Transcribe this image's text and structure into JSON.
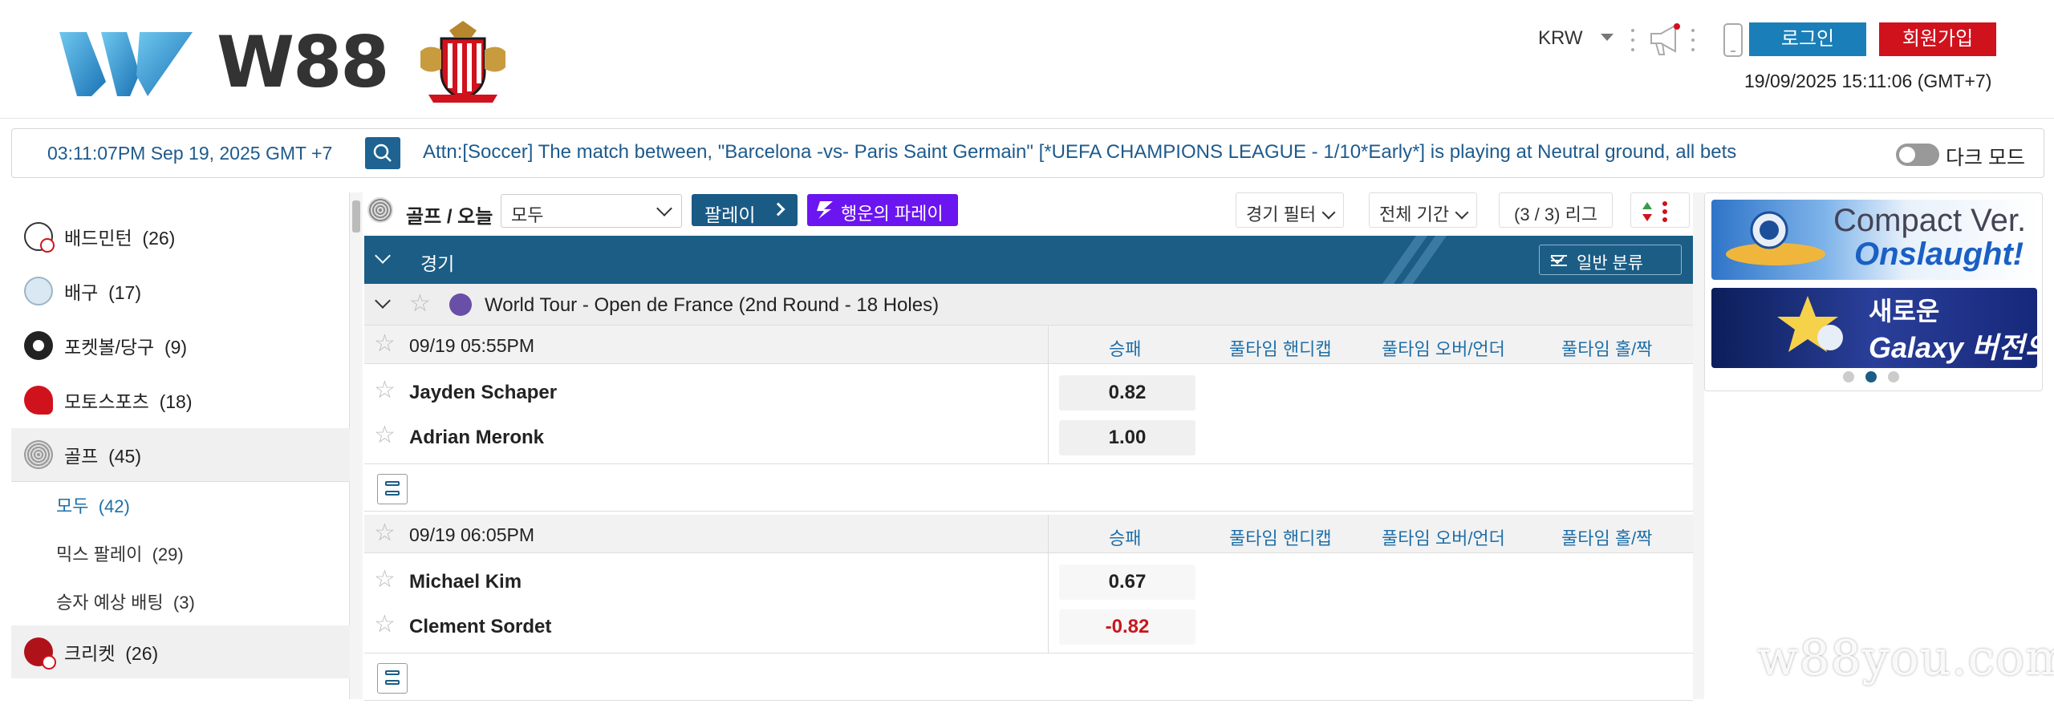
{
  "brand": {
    "name": "W88"
  },
  "header": {
    "currency": "KRW",
    "login_label": "로그인",
    "signup_label": "회원가입",
    "datetime": "19/09/2025 15:11:06 (GMT+7)"
  },
  "ticker": {
    "time": "03:11:07PM Sep 19, 2025 GMT +7",
    "message": "Attn:[Soccer] The match between, \"Barcelona -vs- Paris Saint Germain\" [*UEFA CHAMPIONS LEAGUE - 1/10*Early*] is playing at Neutral ground, all bets",
    "dark_mode_label": "다크 모드"
  },
  "sidebar": {
    "items": [
      {
        "label": "배드민턴",
        "count": "(26)"
      },
      {
        "label": "배구",
        "count": "(17)"
      },
      {
        "label": "포켓볼/당구",
        "count": "(9)"
      },
      {
        "label": "모토스포츠",
        "count": "(18)"
      },
      {
        "label": "골프",
        "count": "(45)"
      },
      {
        "label": "크리켓",
        "count": "(26)"
      }
    ],
    "sub_items": [
      {
        "label": "모두",
        "count": "(42)"
      },
      {
        "label": "믹스 팔레이",
        "count": "(29)"
      },
      {
        "label": "승자 예상 배팅",
        "count": "(3)"
      }
    ]
  },
  "filter_bar": {
    "title": "골프 / 오늘",
    "select_value": "모두",
    "parlay_label": "팔레이",
    "lucky_parlay_label": "행운의 파레이",
    "match_filter_label": "경기 필터",
    "period_label": "전체 기간",
    "league_count": "(3 / 3) 리그"
  },
  "section": {
    "label": "경기",
    "sort_label": "일반 분류"
  },
  "league": {
    "name": "World Tour - Open de France (2nd Round - 18 Holes)"
  },
  "columns": [
    "승패",
    "풀타임 핸디캡",
    "풀타임 오버/언더",
    "풀타임 홀/짝"
  ],
  "matches": [
    {
      "time": "09/19 05:55PM",
      "team1": "Jayden Schaper",
      "team2": "Adrian Meronk",
      "odd1": "0.82",
      "odd2": "1.00"
    },
    {
      "time": "09/19 06:05PM",
      "team1": "Michael Kim",
      "team2": "Clement Sordet",
      "odd1": "0.67",
      "odd2": "-0.82"
    }
  ],
  "banners": [
    {
      "line1": "Compact Ver.",
      "line2": "Onslaught!"
    },
    {
      "line1": "새로운",
      "line2": "Galaxy 버전의"
    }
  ],
  "watermark": "w88you.com",
  "colors": {
    "login": "#1a7fb8",
    "signup": "#d0121d",
    "header": "#1b5d85",
    "lucky": "#6b15f1",
    "negative_odd": "#c8161d"
  }
}
